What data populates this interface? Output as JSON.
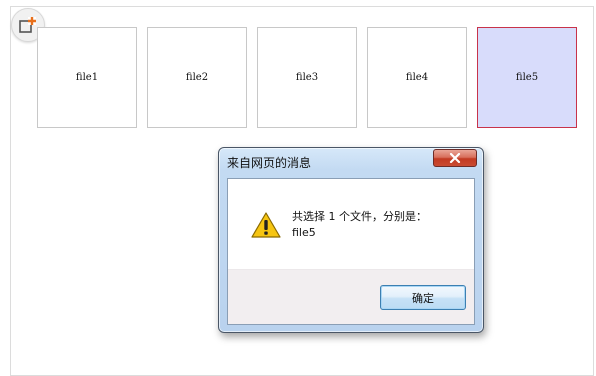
{
  "toolbar": {
    "add_icon": "add-square-icon"
  },
  "files": [
    {
      "label": "file1",
      "selected": false
    },
    {
      "label": "file2",
      "selected": false
    },
    {
      "label": "file3",
      "selected": false
    },
    {
      "label": "file4",
      "selected": false
    },
    {
      "label": "file5",
      "selected": true
    }
  ],
  "dialog": {
    "title": "来自网页的消息",
    "close_icon": "close-icon",
    "icon": "warning-icon",
    "message_line1": "共选择 1 个文件，分别是：",
    "message_line2": "file5",
    "ok_label": "确定"
  },
  "colors": {
    "selected_bg": "#d8dcfb",
    "selected_border": "#c8334a",
    "close_red": "#c23a22",
    "badge_orange": "#e8701c"
  }
}
